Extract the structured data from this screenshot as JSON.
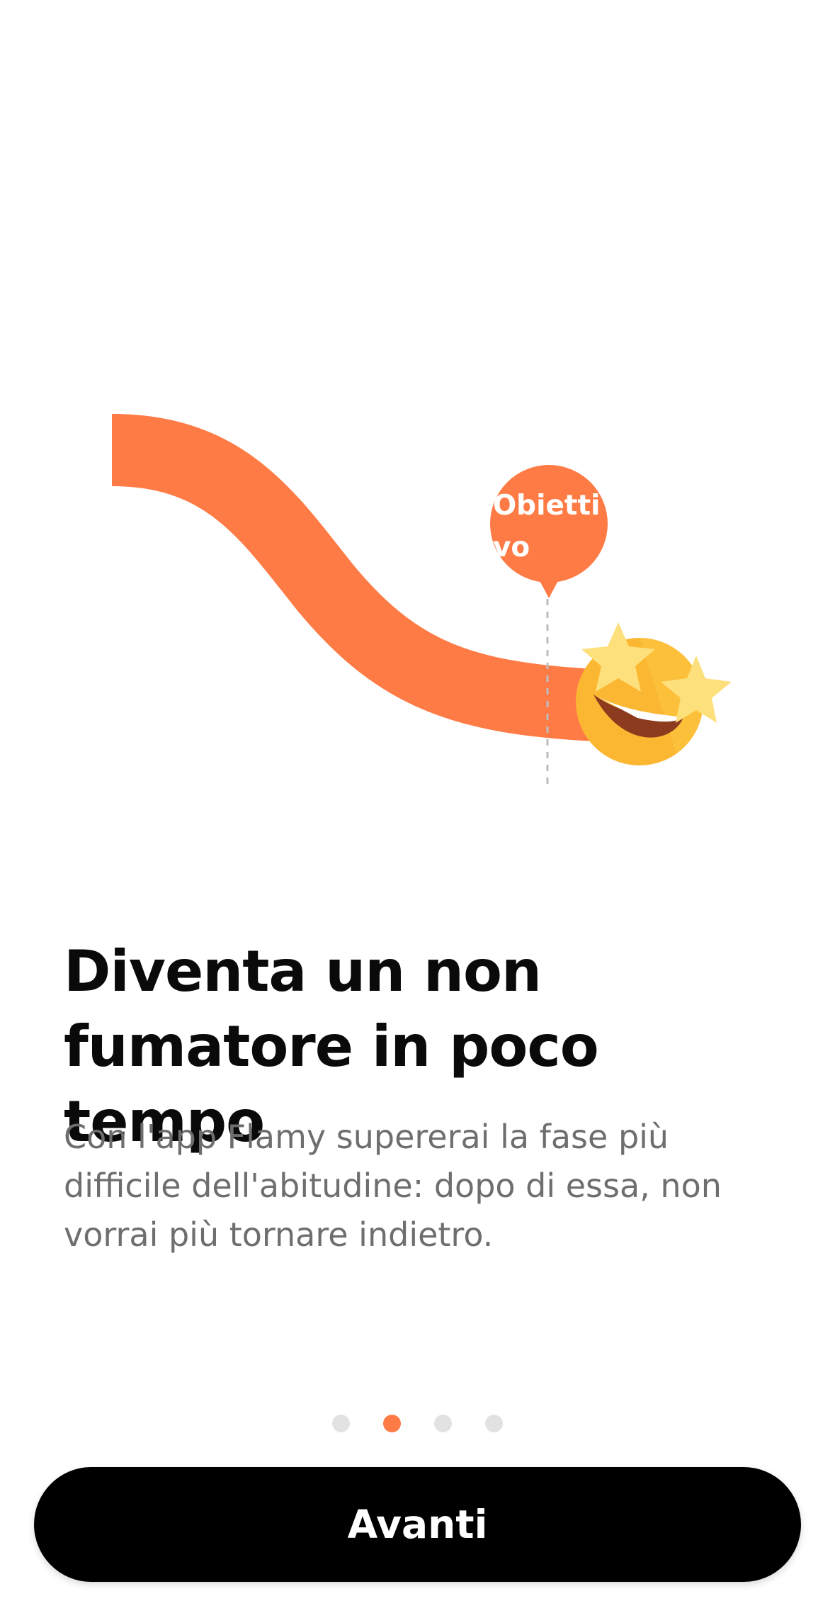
{
  "illustration": {
    "goal_label": "Obiettivo",
    "accent_color": "#ff7b45",
    "mascot_icon": "star-struck-emoji-icon"
  },
  "onboarding": {
    "title": "Diventa un non fumatore in poco tempo",
    "description": "Con l'app Flamy supererai la fase più difficile dell'abitudine: dopo di essa, non vorrai più tornare indietro."
  },
  "pager": {
    "total": 4,
    "current": 2
  },
  "actions": {
    "next_label": "Avanti",
    "button_color": "#000000"
  }
}
